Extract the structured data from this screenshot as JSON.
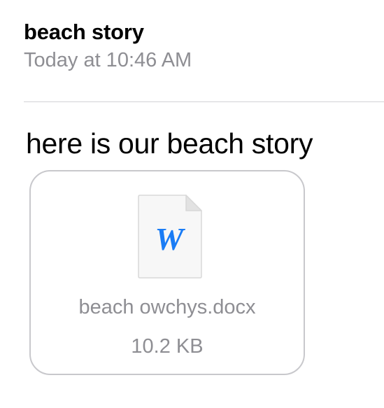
{
  "header": {
    "subject": "beach story",
    "timestamp": "Today at 10:46 AM"
  },
  "message": {
    "body": "here is our beach story"
  },
  "attachment": {
    "icon": "word-document-icon",
    "icon_letter": "W",
    "icon_color": "#1a7cf5",
    "file_name": "beach owchys.docx",
    "file_size": "10.2 KB"
  }
}
